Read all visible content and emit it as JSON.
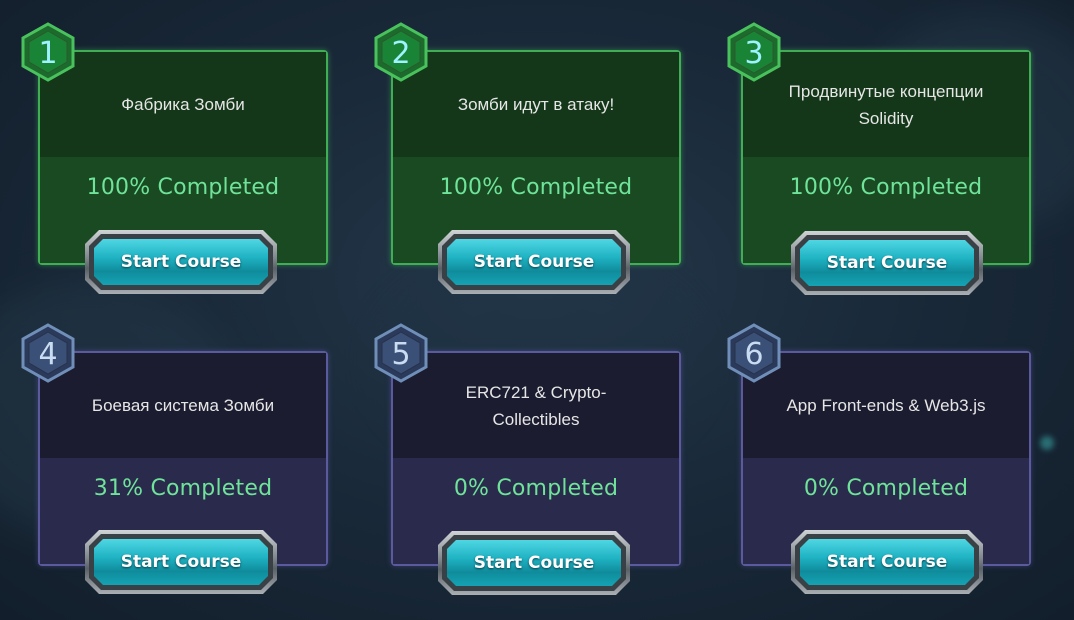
{
  "colors": {
    "completed_card_border": "#3fae54",
    "incomplete_card_border": "#5b5a9e",
    "progress_text": "#6fe39a",
    "button_face": "#1fb3c3"
  },
  "courses": [
    {
      "number": "1",
      "title": "Фабрика Зомби",
      "progress": "100% Completed",
      "progress_value": 100,
      "button_label": "Start Course",
      "status": "completed"
    },
    {
      "number": "2",
      "title": "Зомби идут в атаку!",
      "progress": "100% Completed",
      "progress_value": 100,
      "button_label": "Start Course",
      "status": "completed"
    },
    {
      "number": "3",
      "title": "Продвинутые концепции Solidity",
      "progress": "100% Completed",
      "progress_value": 100,
      "button_label": "Start Course",
      "status": "completed"
    },
    {
      "number": "4",
      "title": "Боевая система Зомби",
      "progress": "31% Completed",
      "progress_value": 31,
      "button_label": "Start Course",
      "status": "in-progress"
    },
    {
      "number": "5",
      "title": "ERC721 & Crypto-Collectibles",
      "progress": "0% Completed",
      "progress_value": 0,
      "button_label": "Start Course",
      "status": "not-started"
    },
    {
      "number": "6",
      "title": "App Front-ends & Web3.js",
      "progress": "0% Completed",
      "progress_value": 0,
      "button_label": "Start Course",
      "status": "not-started"
    }
  ]
}
